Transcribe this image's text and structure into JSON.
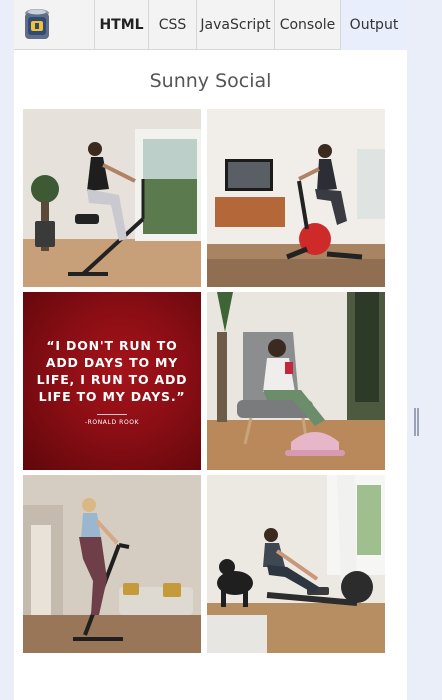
{
  "tabs": [
    {
      "label": "HTML",
      "state": "active"
    },
    {
      "label": "CSS",
      "state": "normal"
    },
    {
      "label": "JavaScript",
      "state": "normal"
    },
    {
      "label": "Console",
      "state": "normal"
    },
    {
      "label": "Output",
      "state": "highlighted"
    }
  ],
  "logo_icon": "battery-jar-icon",
  "page_title": "Sunny Social",
  "images": [
    {
      "subject": "woman on folding exercise bike",
      "icon": "exercise-bike-photo"
    },
    {
      "subject": "woman on spin bike in living room",
      "icon": "spin-bike-photo"
    },
    {
      "subject": "quote card",
      "icon": "quote-card"
    },
    {
      "subject": "woman seated using under-desk pedal exerciser",
      "icon": "pedal-exerciser-photo"
    },
    {
      "subject": "woman on stair stepper",
      "icon": "stepper-photo"
    },
    {
      "subject": "woman on rowing machine with dog",
      "icon": "rowing-machine-photo"
    }
  ],
  "quote": {
    "text": "“I DON'T RUN TO ADD DAYS TO MY LIFE, I RUN TO ADD LIFE TO MY DAYS.”",
    "author": "-RONALD ROOK"
  },
  "colors": {
    "page_bg": "#e9eef8",
    "tab_bar_bg": "#f3f3f3",
    "output_tab_bg": "#e8eefc",
    "quote_bg": "#8a0e14"
  }
}
